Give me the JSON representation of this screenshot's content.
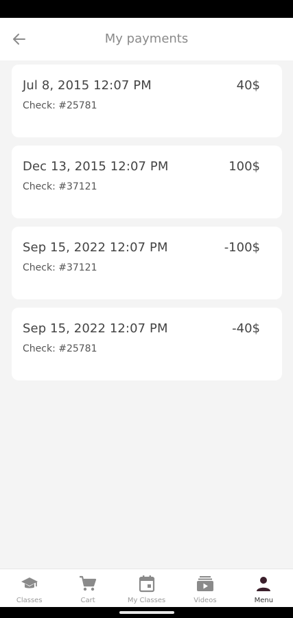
{
  "header": {
    "title": "My payments",
    "back_icon": "arrow-left-icon"
  },
  "payments": [
    {
      "date": "Jul 8, 2015 12:07 PM",
      "amount": "40$",
      "check": "Check: #25781"
    },
    {
      "date": "Dec 13, 2015 12:07 PM",
      "amount": "100$",
      "check": "Check: #37121"
    },
    {
      "date": "Sep 15, 2022 12:07 PM",
      "amount": "-100$",
      "check": "Check: #37121"
    },
    {
      "date": "Sep 15, 2022 12:07 PM",
      "amount": "-40$",
      "check": "Check: #25781"
    }
  ],
  "bottom_nav": {
    "items": [
      {
        "label": "Classes",
        "icon": "graduation-cap-icon"
      },
      {
        "label": "Cart",
        "icon": "cart-icon"
      },
      {
        "label": "My Classes",
        "icon": "calendar-icon"
      },
      {
        "label": "Videos",
        "icon": "video-library-icon"
      },
      {
        "label": "Menu",
        "icon": "person-icon"
      }
    ],
    "active": "Menu"
  },
  "colors": {
    "background": "#f4f4f4",
    "card": "#ffffff",
    "active_icon": "#3b1f2b",
    "inactive_icon": "#8a8a8a"
  }
}
